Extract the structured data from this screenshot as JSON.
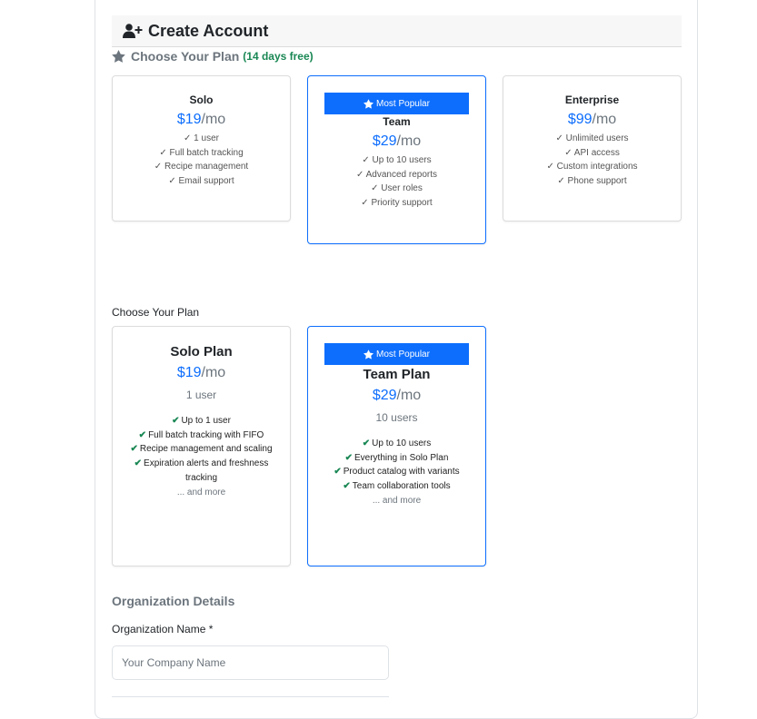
{
  "header": {
    "title": "Create Account",
    "icon": "user-plus-icon"
  },
  "plan_section": {
    "title": "Choose Your Plan",
    "free_note": "(14 days free)",
    "icon": "star-icon"
  },
  "plans_top": [
    {
      "name": "Solo",
      "price": "$19",
      "period": "/mo",
      "features": [
        "✓ 1 user",
        "✓ Full batch tracking",
        "✓ Recipe management",
        "✓ Email support"
      ]
    },
    {
      "badge": "Most Popular",
      "name": "Team",
      "price": "$29",
      "period": "/mo",
      "features": [
        "✓ Up to 10 users",
        "✓ Advanced reports",
        "✓ User roles",
        "✓ Priority support"
      ]
    },
    {
      "name": "Enterprise",
      "price": "$99",
      "period": "/mo",
      "features": [
        "✓ Unlimited users",
        "✓ API access",
        "✓ Custom integrations",
        "✓ Phone support"
      ]
    }
  ],
  "plan_label": "Choose Your Plan",
  "plans_bottom": [
    {
      "name": "Solo Plan",
      "price": "$19",
      "period": "/mo",
      "users": "1 user",
      "features": [
        "Up to 1 user",
        "Full batch tracking with FIFO",
        "Recipe management and scaling",
        "Expiration alerts and freshness tracking"
      ],
      "more": "... and more"
    },
    {
      "badge": "Most Popular",
      "name": "Team Plan",
      "price": "$29",
      "period": "/mo",
      "users": "10 users",
      "features": [
        "Up to 10 users",
        "Everything in Solo Plan",
        "Product catalog with variants",
        "Team collaboration tools"
      ],
      "more": "... and more"
    }
  ],
  "org": {
    "title": "Organization Details",
    "name_label": "Organization Name *",
    "name_value": "",
    "name_placeholder": "Your Company Name"
  },
  "colors": {
    "accent": "#0d6efd",
    "success": "#198754",
    "muted": "#6c757d"
  }
}
